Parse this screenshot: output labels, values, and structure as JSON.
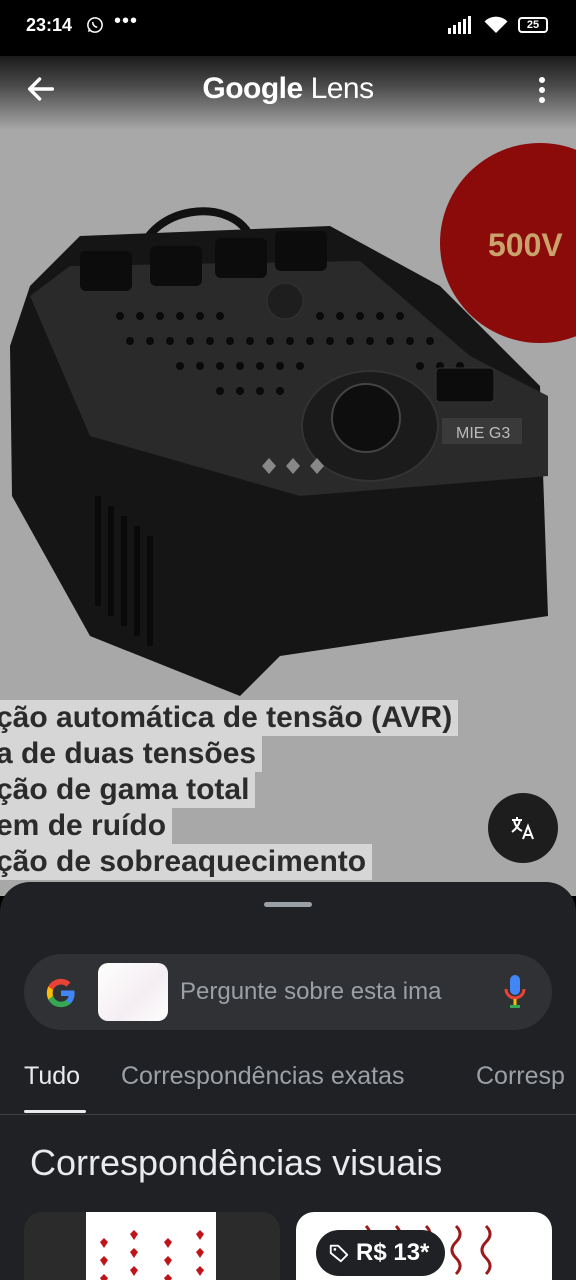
{
  "status_bar": {
    "time": "23:14",
    "battery": "25"
  },
  "header": {
    "title_brand": "Google",
    "title_product": "Lens"
  },
  "image": {
    "badge_text": "500V",
    "product_label": "MIE G3",
    "overlay_lines": [
      "ção automática de tensão (AVR)",
      "a de duas tensões",
      "ção de gama total",
      "em de ruído",
      "ção de sobreaquecimento"
    ]
  },
  "search": {
    "placeholder": "Pergunte sobre esta ima"
  },
  "tabs": [
    {
      "label": "Tudo"
    },
    {
      "label": "Correspondências exatas"
    },
    {
      "label": "Corresp"
    }
  ],
  "section_title": "Correspondências visuais",
  "price_chip": "R$ 13*",
  "colors": {
    "sheet_bg": "#202124",
    "accent_red": "#8b0a0a",
    "tab_active": "#e8eaed",
    "muted": "#9aa0a6"
  }
}
